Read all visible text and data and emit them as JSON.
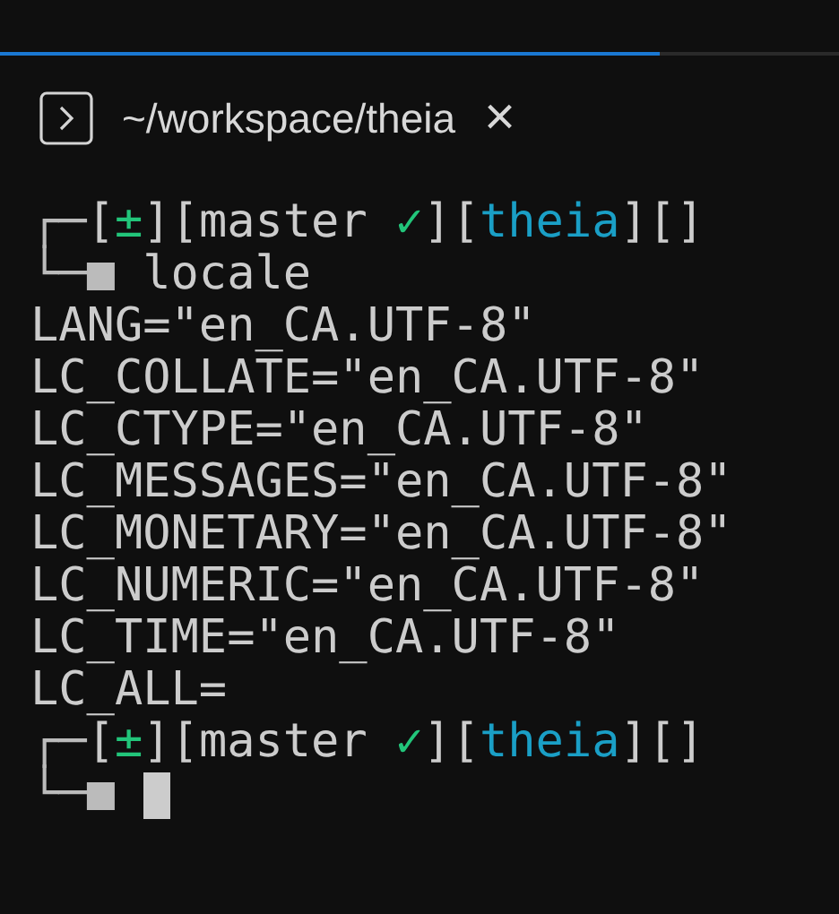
{
  "tab": {
    "title": "~/workspace/theia",
    "close": "×",
    "selected": true
  },
  "terminal": [
    {
      "kind": "prompt",
      "corner": "┌─",
      "segments": [
        {
          "kind": "bracket",
          "text": "["
        },
        {
          "kind": "status",
          "text": "±"
        },
        {
          "kind": "bracket",
          "text": "]["
        },
        {
          "kind": "plain",
          "text": "master "
        },
        {
          "kind": "status",
          "text": "✓"
        },
        {
          "kind": "bracket",
          "text": "]["
        },
        {
          "kind": "dir",
          "text": "theia"
        },
        {
          "kind": "bracket",
          "text": "][]"
        }
      ]
    },
    {
      "kind": "command",
      "corner": "└─",
      "marker": "■",
      "text": "locale"
    },
    {
      "kind": "output",
      "text": "LANG=\"en_CA.UTF-8\""
    },
    {
      "kind": "output",
      "text": "LC_COLLATE=\"en_CA.UTF-8\""
    },
    {
      "kind": "output",
      "text": "LC_CTYPE=\"en_CA.UTF-8\""
    },
    {
      "kind": "output",
      "text": "LC_MESSAGES=\"en_CA.UTF-8\""
    },
    {
      "kind": "output",
      "text": "LC_MONETARY=\"en_CA.UTF-8\""
    },
    {
      "kind": "output",
      "text": "LC_NUMERIC=\"en_CA.UTF-8\""
    },
    {
      "kind": "output",
      "text": "LC_TIME=\"en_CA.UTF-8\""
    },
    {
      "kind": "output",
      "text": "LC_ALL="
    },
    {
      "kind": "prompt",
      "corner": "┌─",
      "segments": [
        {
          "kind": "bracket",
          "text": "["
        },
        {
          "kind": "status",
          "text": "±"
        },
        {
          "kind": "bracket",
          "text": "]["
        },
        {
          "kind": "plain",
          "text": "master "
        },
        {
          "kind": "status",
          "text": "✓"
        },
        {
          "kind": "bracket",
          "text": "]["
        },
        {
          "kind": "dir",
          "text": "theia"
        },
        {
          "kind": "bracket",
          "text": "][]"
        }
      ]
    },
    {
      "kind": "command",
      "corner": "└─",
      "marker": "■",
      "cursor": true
    }
  ]
}
